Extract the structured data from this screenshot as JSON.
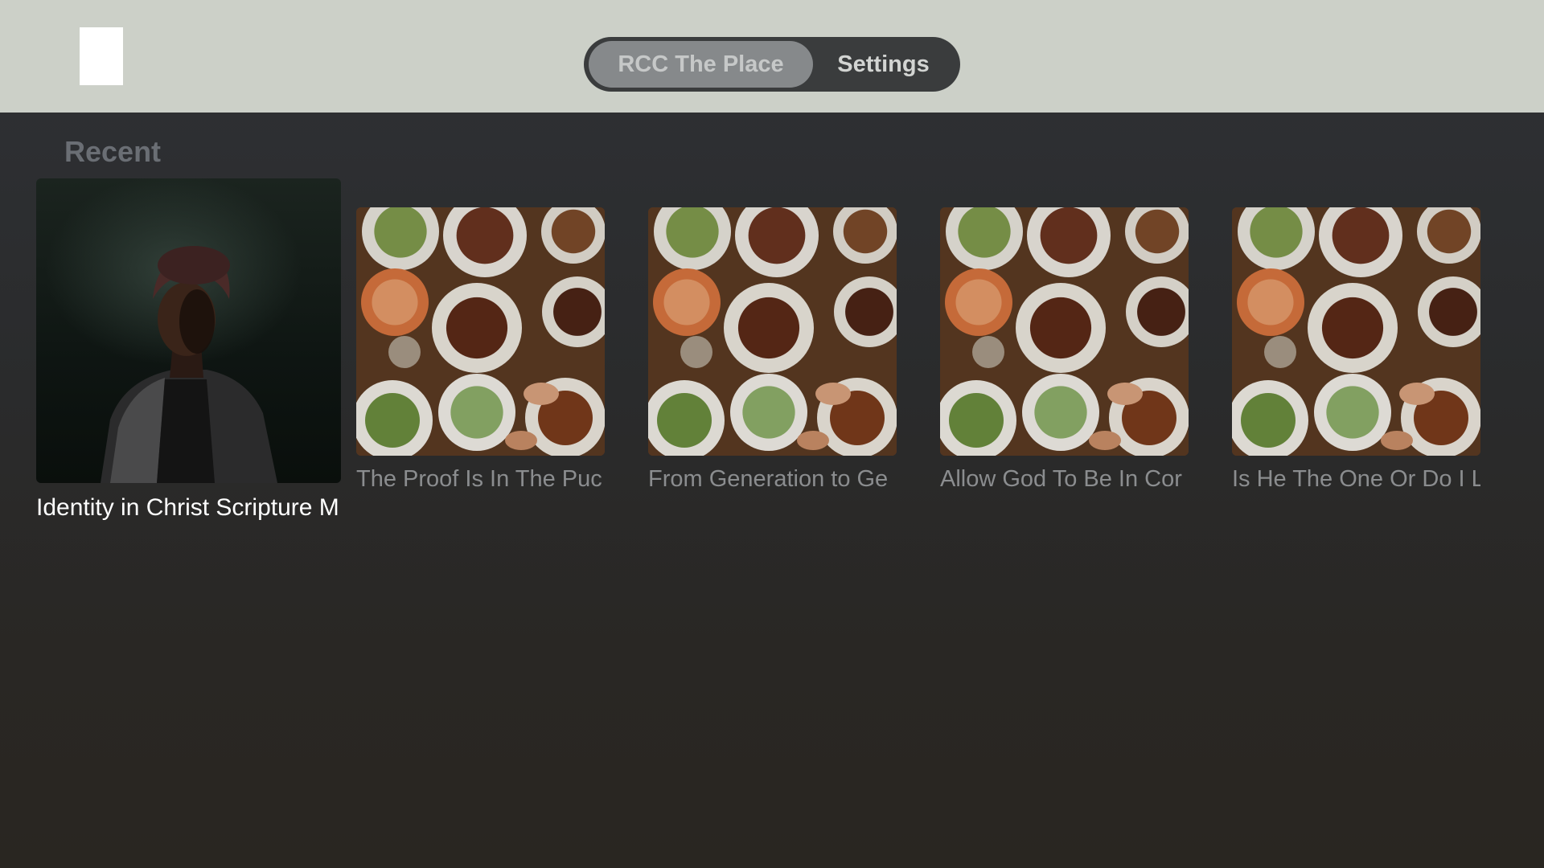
{
  "header": {
    "tabs": [
      {
        "label": "RCC The Place",
        "selected": true
      },
      {
        "label": "Settings",
        "selected": false
      }
    ]
  },
  "recent": {
    "title": "Recent",
    "items": [
      {
        "title": "Identity in Christ Scripture M",
        "focused": true
      },
      {
        "title": "The Proof Is In The Puc",
        "focused": false
      },
      {
        "title": "From Generation to Ge",
        "focused": false
      },
      {
        "title": "Allow God To Be In Cor",
        "focused": false
      },
      {
        "title": "Is He The One Or Do I L",
        "focused": false
      }
    ]
  },
  "colors": {
    "topbar": "#ccd0c8",
    "tab_selected": "#86898b",
    "tabbar": "#3a3c3d",
    "background": "#2c2d2e"
  }
}
